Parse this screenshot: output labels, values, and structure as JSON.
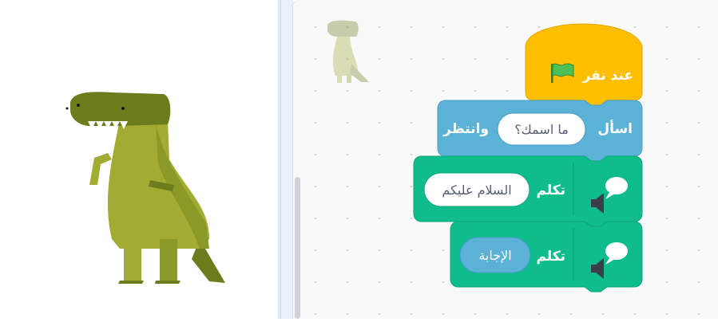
{
  "stage": {
    "sprite": "dinosaur-sprite"
  },
  "workspace": {
    "sprite_thumbnail": "dinosaur-sprite-thumbnail",
    "script": {
      "hat_block": {
        "label": "عند نقر",
        "icon": "green-flag-icon",
        "color": "#ffbf00"
      },
      "ask_block": {
        "label_start": "اسأل",
        "input_value": "ما اسمك؟",
        "label_end": "وانتظر",
        "color": "#5cb1d6"
      },
      "say_block_1": {
        "label": "تكلم",
        "input_value": "السلام عليكم",
        "icon": "speech-bubble-speaker-icon",
        "color": "#0fbd8c"
      },
      "say_block_2": {
        "label": "تكلم",
        "reporter_value": "الإجابة",
        "icon": "speech-bubble-speaker-icon",
        "color": "#0fbd8c",
        "reporter_color": "#5cb1d6"
      }
    }
  }
}
